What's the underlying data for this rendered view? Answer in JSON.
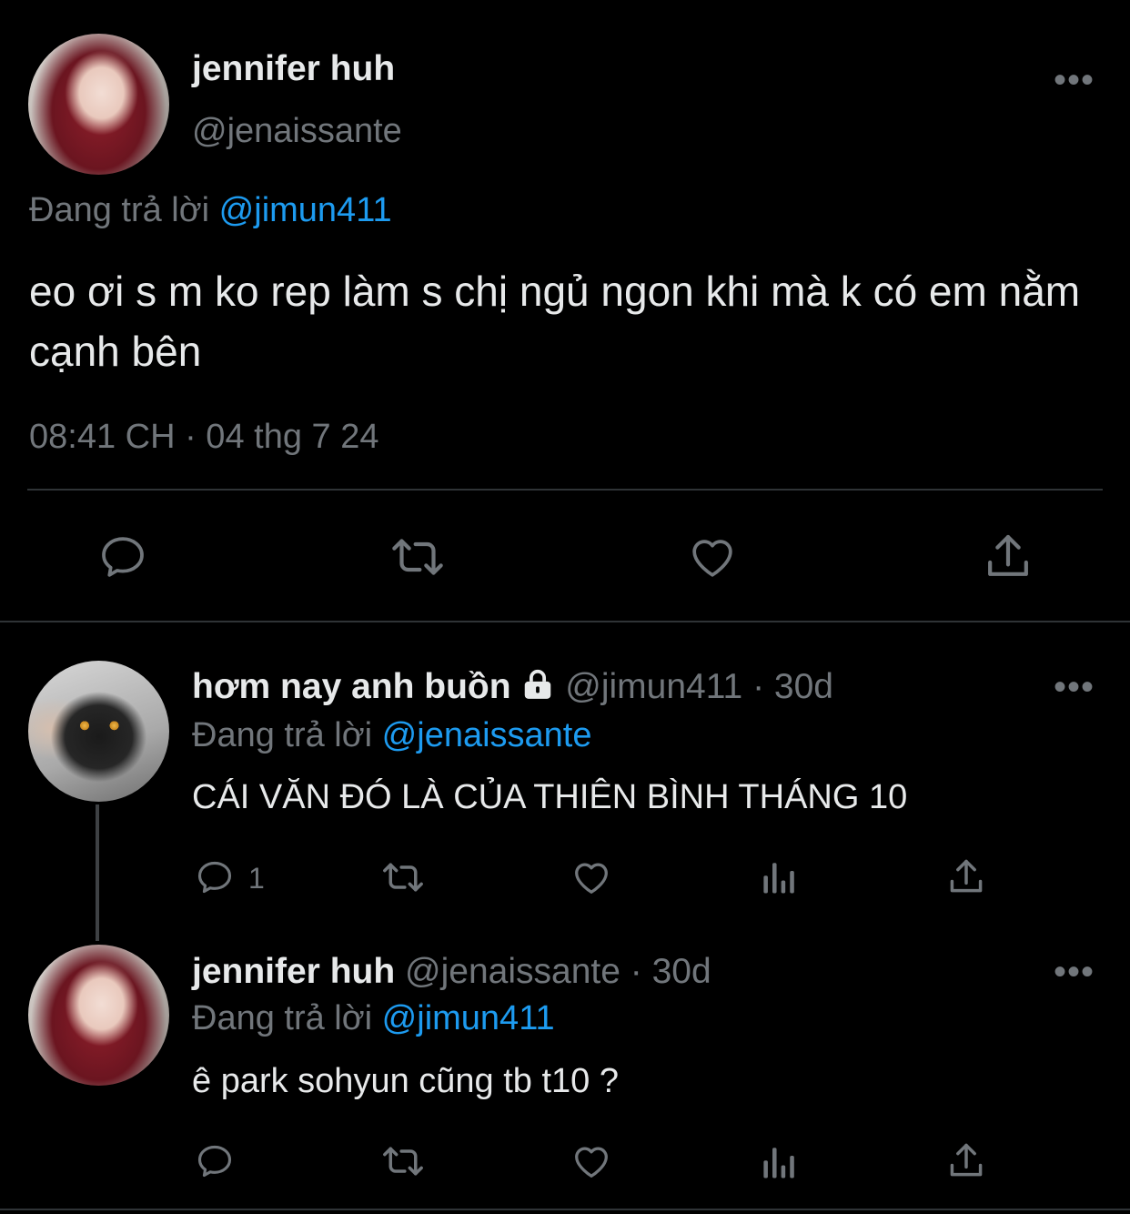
{
  "main_tweet": {
    "display_name": "jennifer huh",
    "handle": "@jenaissante",
    "reply_prefix": "Đang trả lời",
    "reply_to": "@jimun411",
    "text": "eo ơi s m ko rep làm s chị ngủ ngon khi mà k có em nằm cạnh bên",
    "timestamp": "08:41 CH · 04 thg 7 24"
  },
  "reply_1": {
    "display_name": "hơm nay anh buồn",
    "handle": "@jimun411",
    "separator": "·",
    "age": "30d",
    "reply_prefix": "Đang trả lời",
    "reply_to": "@jenaissante",
    "text": "CÁI VĂN ĐÓ LÀ CỦA THIÊN BÌNH THÁNG 10",
    "reply_count": "1"
  },
  "reply_2": {
    "display_name": "jennifer huh",
    "handle": "@jenaissante",
    "separator": "·",
    "age": "30d",
    "reply_prefix": "Đang trả lời",
    "reply_to": "@jimun411",
    "text": "ê park sohyun cũng tb t10 ?"
  },
  "icons": {
    "more": "more-dots-icon",
    "reply": "reply-bubble-icon",
    "retweet": "retweet-icon",
    "like": "heart-icon",
    "views": "views-bar-chart-icon",
    "share": "share-icon",
    "protected": "lock-icon"
  },
  "colors": {
    "background": "#000000",
    "text": "#e7e9ea",
    "muted": "#71767b",
    "link": "#1d9bf0",
    "divider": "#2f3336"
  }
}
